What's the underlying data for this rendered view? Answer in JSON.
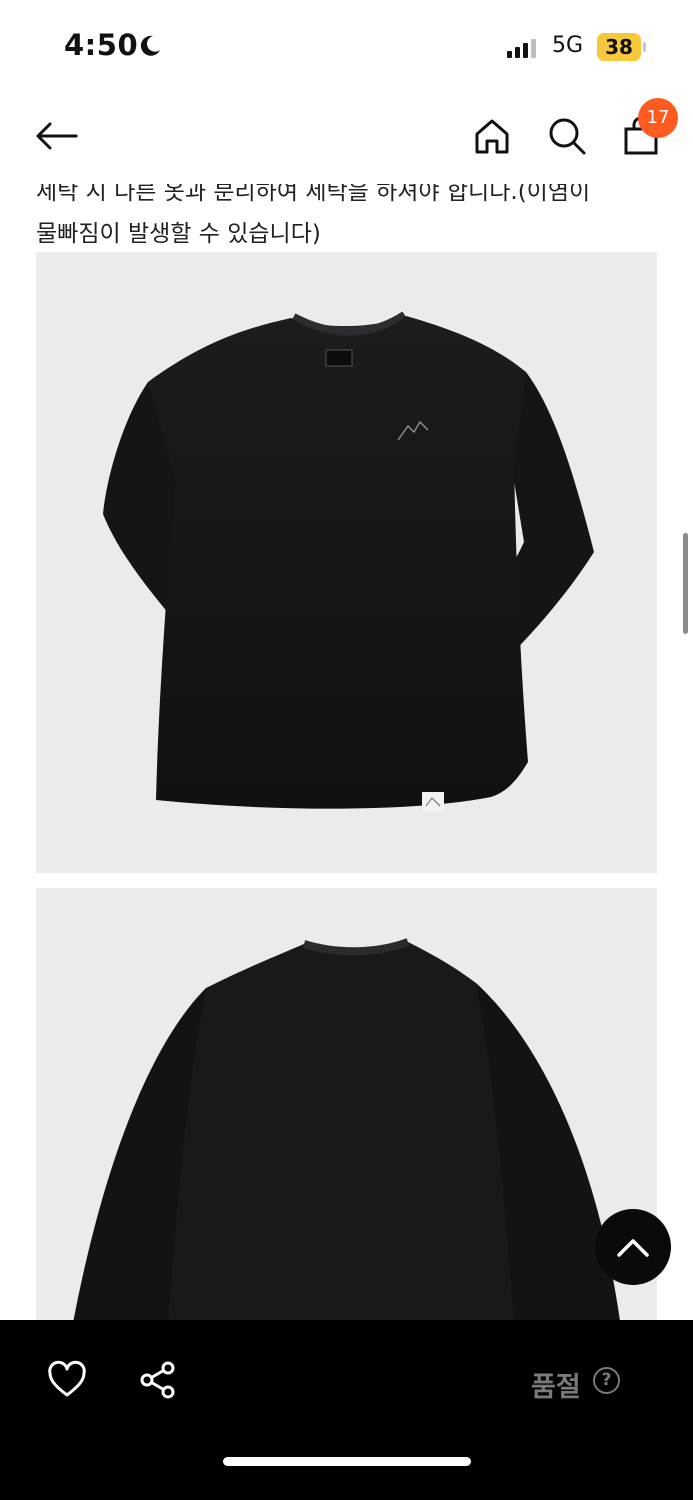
{
  "status_bar": {
    "time": "4:50",
    "network": "5G",
    "battery": "38"
  },
  "nav": {
    "cart_count": "17"
  },
  "description": {
    "cut_line": "세탁 시 다른 옷과 분리하여 세탁을 하셔야 합니다.(이염이",
    "line": "물빠짐이 발생할 수 있습니다)"
  },
  "bottom_bar": {
    "status_label": "품절",
    "help_glyph": "?"
  },
  "colors": {
    "accent_badge": "#ff5a1f",
    "battery": "#f7c93a",
    "bottom_bar": "#000000",
    "muted_text": "#7a7a7a"
  },
  "icons": {
    "back": "back-arrow-icon",
    "home": "home-icon",
    "search": "search-icon",
    "bag": "shopping-bag-icon",
    "heart": "heart-icon",
    "share": "share-icon",
    "scroll_top": "chevron-up-icon"
  }
}
